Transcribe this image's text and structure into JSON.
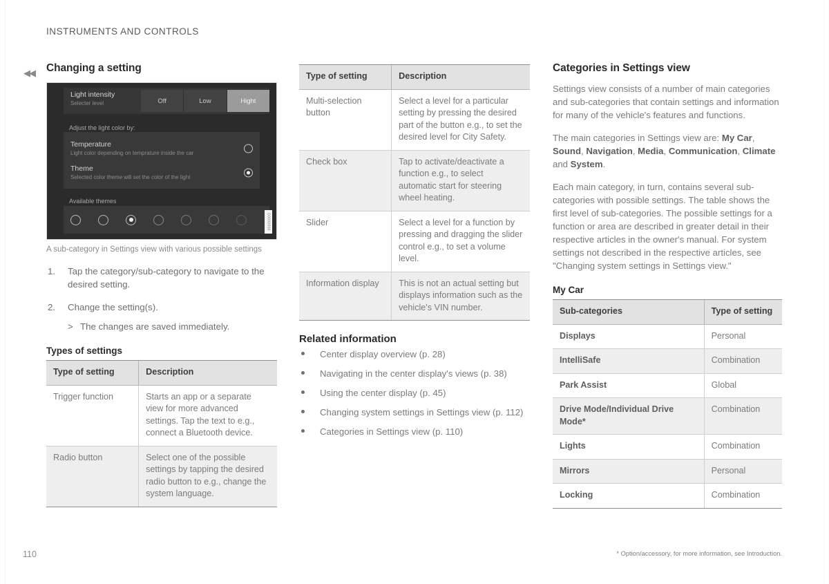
{
  "header": {
    "running_head": "INSTRUMENTS AND CONTROLS"
  },
  "nav": {
    "back_chevron": "◀◀"
  },
  "left_column": {
    "title": "Changing a setting",
    "device_screenshot": {
      "toolbar": {
        "title": "Light intensity",
        "subtitle": "Selecter level",
        "segments": [
          "Off",
          "Low",
          "Hight"
        ],
        "active_segment": "Hight"
      },
      "group_heading": "Adjust the light color by:",
      "options": [
        {
          "title": "Temperature",
          "subtitle": "Light color depending on temprature inside the car",
          "selected": false
        },
        {
          "title": "Theme",
          "subtitle": "Selected color theme will set the color of the light",
          "selected": true
        }
      ],
      "themes_label": "Available themes",
      "theme_count": 7,
      "theme_selected_index": 2,
      "watermark": "G0000000"
    },
    "figure_caption": "A sub-category in Settings view with various possible settings",
    "steps": [
      {
        "num": "1.",
        "text": "Tap the category/sub-category to navigate to the desired setting."
      },
      {
        "num": "2.",
        "text": "Change the setting(s).",
        "substep": "The changes are saved immediately.",
        "substep_marker": ">"
      }
    ],
    "table_title": "Types of settings",
    "table": {
      "headers": [
        "Type of setting",
        "Description"
      ],
      "rows": [
        {
          "type": "Trigger function",
          "description": "Starts an app or a separate view for more advanced settings. Tap the text to e.g., connect a Bluetooth device.",
          "shaded": false
        },
        {
          "type": "Radio button",
          "description": "Select one of the possible settings by tapping the desired radio button to e.g., change the system language.",
          "shaded": true
        }
      ]
    }
  },
  "middle_column": {
    "table": {
      "headers": [
        "Type of setting",
        "Description"
      ],
      "rows": [
        {
          "type": "Multi-selection button",
          "description": "Select a level for a particular setting by pressing the desired part of the button e.g., to set the desired level for City Safety.",
          "shaded": false
        },
        {
          "type": "Check box",
          "description": "Tap to activate/deactivate a function e.g., to select automatic start for steering wheel heating.",
          "shaded": true
        },
        {
          "type": "Slider",
          "description": "Select a level for a function by pressing and dragging the slider control e.g., to set a volume level.",
          "shaded": false
        },
        {
          "type": "Information display",
          "description": "This is not an actual setting but displays information such as the vehicle's VIN number.",
          "shaded": true
        }
      ]
    },
    "related_title": "Related information",
    "related_links": [
      "Center display overview (p. 28)",
      "Navigating in the center display's views (p. 38)",
      "Using the center display (p. 45)",
      "Changing system settings in Settings view (p. 112)",
      "Categories in Settings view (p. 110)"
    ]
  },
  "right_column": {
    "title": "Categories in Settings view",
    "paragraph_1": "Settings view consists of a number of main categories and sub-categories that contain settings and information for many of the vehicle's features and functions.",
    "paragraph_2_prefix": "The main categories in Settings view are: ",
    "paragraph_2_categories": [
      "My Car",
      "Sound",
      "Navigation",
      "Media",
      "Communication",
      "Climate",
      "System"
    ],
    "paragraph_2_conjunction": " and ",
    "paragraph_3": "Each main category, in turn, contains several sub-categories with possible settings. The table shows the first level of sub-categories. The possible settings for a function or area are described in greater detail in their respective articles in the owner's manual. For system settings not described in the respective articles, see \"Changing system settings in Settings view.\"",
    "table_title": "My Car",
    "table": {
      "headers": [
        "Sub-categories",
        "Type of setting"
      ],
      "rows": [
        {
          "name": "Displays",
          "type": "Personal",
          "shaded": false
        },
        {
          "name": "IntelliSafe",
          "type": "Combination",
          "shaded": true
        },
        {
          "name": "Park Assist",
          "type": "Global",
          "shaded": false
        },
        {
          "name": "Drive Mode/Individual Drive Mode*",
          "type": "Combination",
          "shaded": true
        },
        {
          "name": "Lights",
          "type": "Combination",
          "shaded": false
        },
        {
          "name": "Mirrors",
          "type": "Personal",
          "shaded": true
        },
        {
          "name": "Locking",
          "type": "Combination",
          "shaded": false
        }
      ]
    }
  },
  "footer": {
    "page_number": "110",
    "note": "* Option/accessory, for more information, see Introduction."
  }
}
